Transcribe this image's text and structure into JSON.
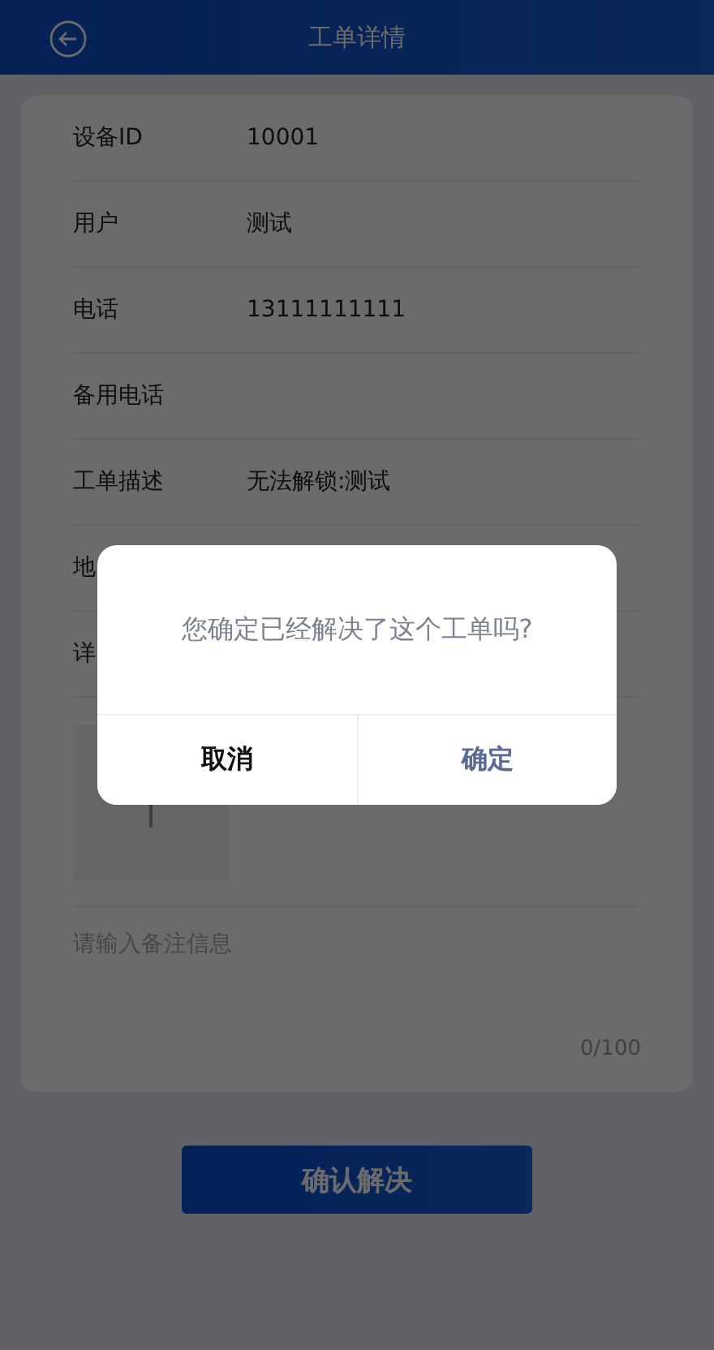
{
  "header": {
    "title": "工单详情"
  },
  "fields": [
    {
      "label": "设备ID",
      "value": "10001"
    },
    {
      "label": "用户",
      "value": "测试"
    },
    {
      "label": "电话",
      "value": "13111111111"
    },
    {
      "label": "备用电话"
    },
    {
      "label": "工单描述",
      "value": "无法解锁:测试"
    },
    {
      "label": "地"
    },
    {
      "label": "详"
    }
  ],
  "remark": {
    "placeholder": "请输入备注信息",
    "counter": "0/100"
  },
  "submit_button": "确认解决",
  "dialog": {
    "message": "您确定已经解决了这个工单吗?",
    "buttons": [
      {
        "label": "取消",
        "kind": "cancel"
      },
      {
        "label": "确定",
        "kind": "confirm"
      }
    ]
  }
}
